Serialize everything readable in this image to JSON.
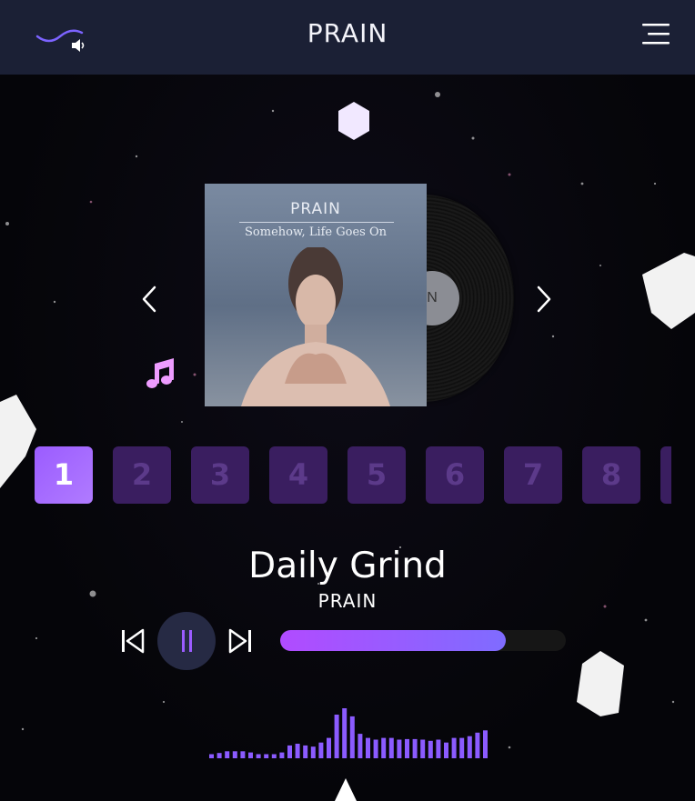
{
  "header": {
    "brand": "PRAIN",
    "logo_icon": "wave-icon",
    "sound_icon": "speaker-icon",
    "menu_icon": "hamburger-menu-icon"
  },
  "album": {
    "brand": "PRAIN",
    "subtitle": "Somehow, Life Goes On",
    "vinyl_label": "N"
  },
  "navigation": {
    "prev_icon": "chevron-left-icon",
    "next_icon": "chevron-right-icon"
  },
  "tracks": {
    "items": [
      "1",
      "2",
      "3",
      "4",
      "5",
      "6",
      "7",
      "8"
    ],
    "active_index": 0
  },
  "now_playing": {
    "title": "Daily Grind",
    "artist": "PRAIN"
  },
  "controls": {
    "prev_icon": "skip-back-icon",
    "pause_icon": "pause-icon",
    "next_icon": "skip-forward-icon",
    "progress": 0.79
  },
  "equalizer": {
    "levels": [
      0.07,
      0.09,
      0.12,
      0.12,
      0.12,
      0.1,
      0.07,
      0.07,
      0.07,
      0.1,
      0.22,
      0.25,
      0.22,
      0.2,
      0.27,
      0.35,
      0.75,
      0.86,
      0.72,
      0.42,
      0.35,
      0.32,
      0.35,
      0.35,
      0.32,
      0.33,
      0.33,
      0.32,
      0.3,
      0.32,
      0.27,
      0.35,
      0.35,
      0.38,
      0.44,
      0.48
    ]
  },
  "colors": {
    "accent": "#9b5cff",
    "header_bg": "#1b2035",
    "track_inactive": "#3a1e60",
    "eq_bar": "#8b5bff"
  }
}
